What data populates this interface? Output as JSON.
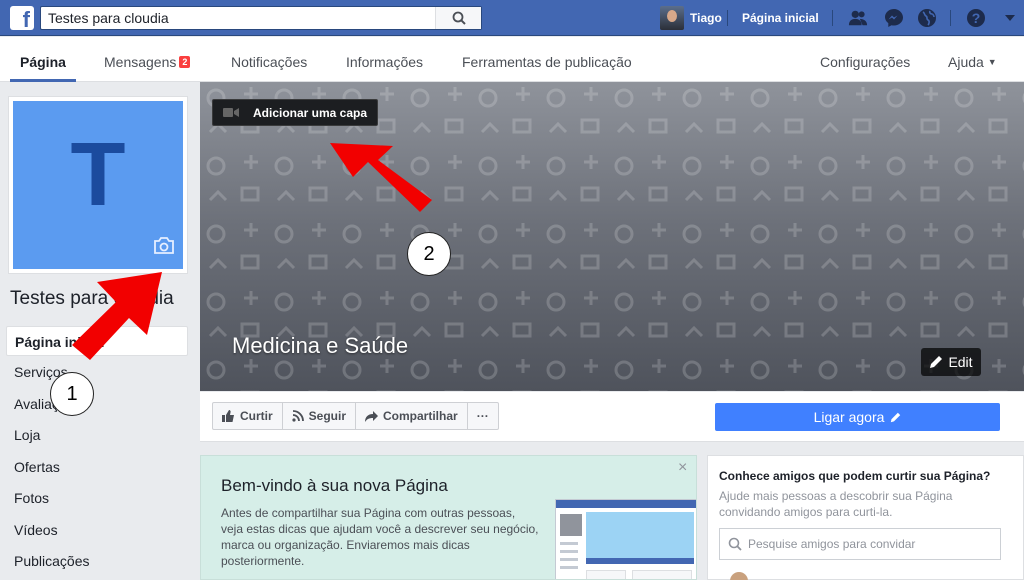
{
  "topbar": {
    "search_value": "Testes para cloudia",
    "user_name": "Tiago",
    "home_label": "Página inicial"
  },
  "tabs": [
    {
      "label": "Página"
    },
    {
      "label": "Mensagens",
      "badge": "2"
    },
    {
      "label": "Notificações"
    },
    {
      "label": "Informações"
    },
    {
      "label": "Ferramentas de publicação"
    },
    {
      "label": "Configurações"
    },
    {
      "label": "Ajuda"
    }
  ],
  "profile": {
    "initial": "T",
    "page_name": "Testes para cloudia"
  },
  "sidebar": {
    "items": [
      {
        "label": "Página inicial"
      },
      {
        "label": "Serviços"
      },
      {
        "label": "Avaliações"
      },
      {
        "label": "Loja"
      },
      {
        "label": "Ofertas"
      },
      {
        "label": "Fotos"
      },
      {
        "label": "Vídeos"
      },
      {
        "label": "Publicações"
      }
    ]
  },
  "cover": {
    "add_cover_label": "Adicionar uma capa",
    "category": "Medicina e Saúde",
    "edit_label": "Edit"
  },
  "actions": {
    "like_label": "Curtir",
    "follow_label": "Seguir",
    "share_label": "Compartilhar",
    "more_label": "···",
    "call_label": "Ligar agora"
  },
  "welcome": {
    "title": "Bem-vindo à sua nova Página",
    "text": "Antes de compartilhar sua Página com outras pessoas, veja estas dicas que ajudam você a descrever seu negócio, marca ou organização. Enviaremos mais dicas posteriormente.",
    "close": "×"
  },
  "friends": {
    "title": "Conhece amigos que podem curtir sua Página?",
    "text": "Ajude mais pessoas a descobrir sua Página convidando amigos para curti-la.",
    "search_placeholder": "Pesquise amigos para convidar"
  },
  "annotations": {
    "marker_1": "1",
    "marker_2": "2",
    "arrow_color": "#f20000"
  },
  "colors": {
    "brand_blue": "#4267b2",
    "call_button": "#4080ff",
    "profile_bg": "#5b9bf0"
  }
}
